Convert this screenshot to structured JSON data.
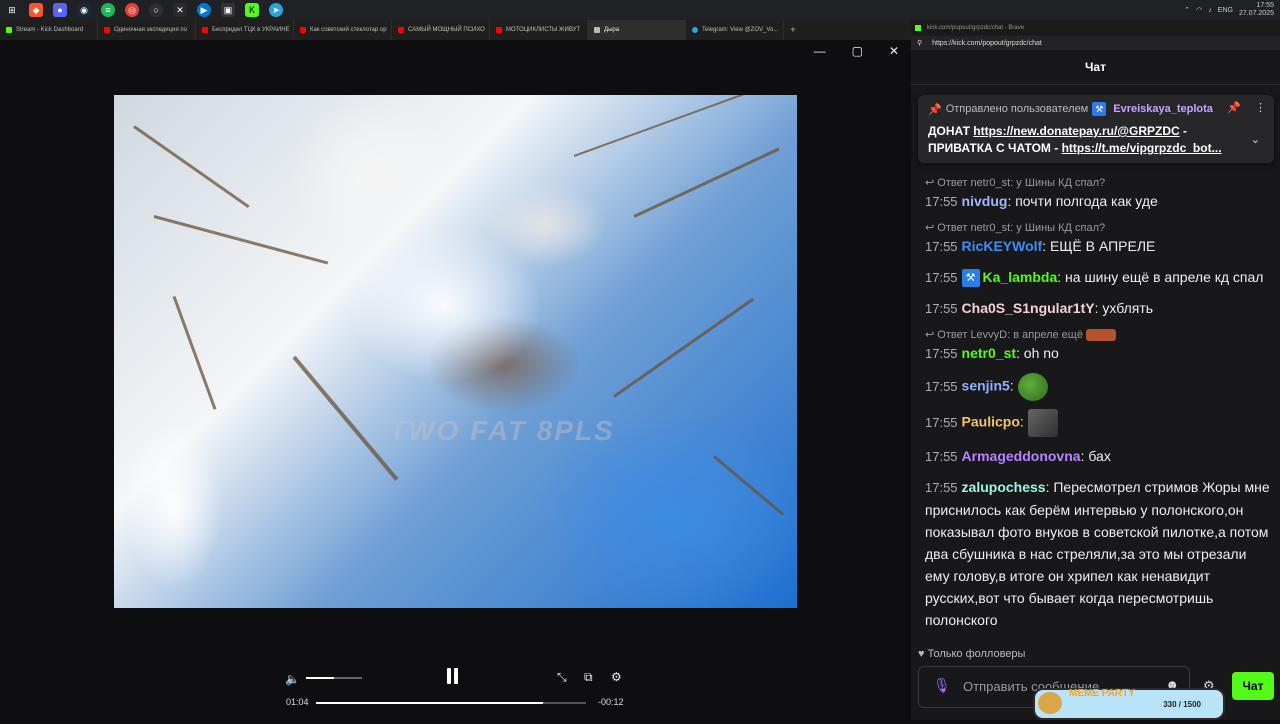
{
  "taskbar": {
    "icons": [
      "windows-icon",
      "brave-icon",
      "discord-icon",
      "steam-icon",
      "spotify-icon",
      "chrome-icon",
      "obs-icon",
      "epic-icon",
      "app-icon",
      "app-icon",
      "kick-icon",
      "telegram-icon"
    ],
    "lang": "ENG",
    "time": "17:55",
    "date": "27.07.2025"
  },
  "tabs": [
    {
      "label": "Stream - Kick Dashboard",
      "color": "#53fc18"
    },
    {
      "label": "Одиночная экспедиция по",
      "color": "#ff0000"
    },
    {
      "label": "Беспредел ТЦК в УКРАИНЕ",
      "color": "#ff0000"
    },
    {
      "label": "Как советский стеклотар ор",
      "color": "#ff0000"
    },
    {
      "label": "САМЫЙ МОЩНЫЙ ПСИХО",
      "color": "#ff0000"
    },
    {
      "label": "МОТОЦИКЛИСТЫ ЖИВУТ",
      "color": "#ff0000"
    },
    {
      "label": "Дыра",
      "color": "#bbbbbb",
      "active": true
    },
    {
      "label": "Telegram: View @ZOV_Vo...",
      "color": "#2aa3e0"
    }
  ],
  "video": {
    "watermark": "TWO FAT 8PLS"
  },
  "player": {
    "current_time": "01:04",
    "remaining_time": "-00:12",
    "progress": 0.84,
    "volume": 0.5
  },
  "chat_window": {
    "title": "kick.com/popout/grpzdc/chat - Brave",
    "url": "https://kick.com/popout/grpzdc/chat",
    "header": "Чат"
  },
  "pinned": {
    "by_label": "Отправлено пользователем",
    "user": "Evreiskaya_teplota",
    "line1_prefix": "ДОНАТ ",
    "line1_link": "https://new.donatepay.ru/@GRPZDC",
    "line1_suffix": " -",
    "line2_prefix": "ПРИВАТКА С ЧАТОМ - ",
    "line2_link": "https://t.me/vipgrpzdc_bot..."
  },
  "messages": [
    {
      "reply": "Ответ netr0_st: у Шины КД спал?",
      "time": "17:55",
      "user": "nivdug",
      "color": "#a0b8ff",
      "text": "почти полгода как уде"
    },
    {
      "reply": "Ответ netr0_st: у Шины КД спал?",
      "time": "17:55",
      "user": "RicKEYWolf",
      "color": "#3e8ef7",
      "text": "ЕЩЁ В АПРЕЛЕ"
    },
    {
      "time": "17:55",
      "user": "Ka_lambda",
      "color": "#53fc18",
      "badge": true,
      "text": "на шину ещё в апреле кд спал"
    },
    {
      "time": "17:55",
      "user": "Cha0S_S1ngular1tY",
      "color": "#f5d0d5",
      "text": "ухблять"
    },
    {
      "reply": "Ответ LevvyD: в апреле ещё",
      "time": "17:55",
      "user": "netr0_st",
      "color": "#53fc18",
      "text": "oh no"
    },
    {
      "time": "17:55",
      "user": "senjin5",
      "color": "#8fb0ff",
      "emote": "pepe",
      "text": ""
    },
    {
      "time": "17:55",
      "user": "Paulicpo",
      "color": "#f0c46a",
      "emote": "gray",
      "text": ""
    },
    {
      "time": "17:55",
      "user": "Armageddonovna",
      "color": "#b983ff",
      "text": "бах"
    },
    {
      "time": "17:55",
      "user": "zalupochess",
      "color": "#9ef5e6",
      "text": "Пересмотрел стримов Жоры мне приснилось как берём интервью у полонского,он показывал фото внуков в советской пилотке,а потом два сбушника в нас стреляли,за это мы отрезали ему голову,в итоге он хрипел как ненавидит русских,вот что бывает когда пересмотришь полонского"
    }
  ],
  "followers_only": "Только фолловеры",
  "input_placeholder": "Отправить сообщение",
  "send_label": "Чат",
  "meme_party": {
    "title": "MEME PARTY",
    "count": "330 / 1500"
  }
}
